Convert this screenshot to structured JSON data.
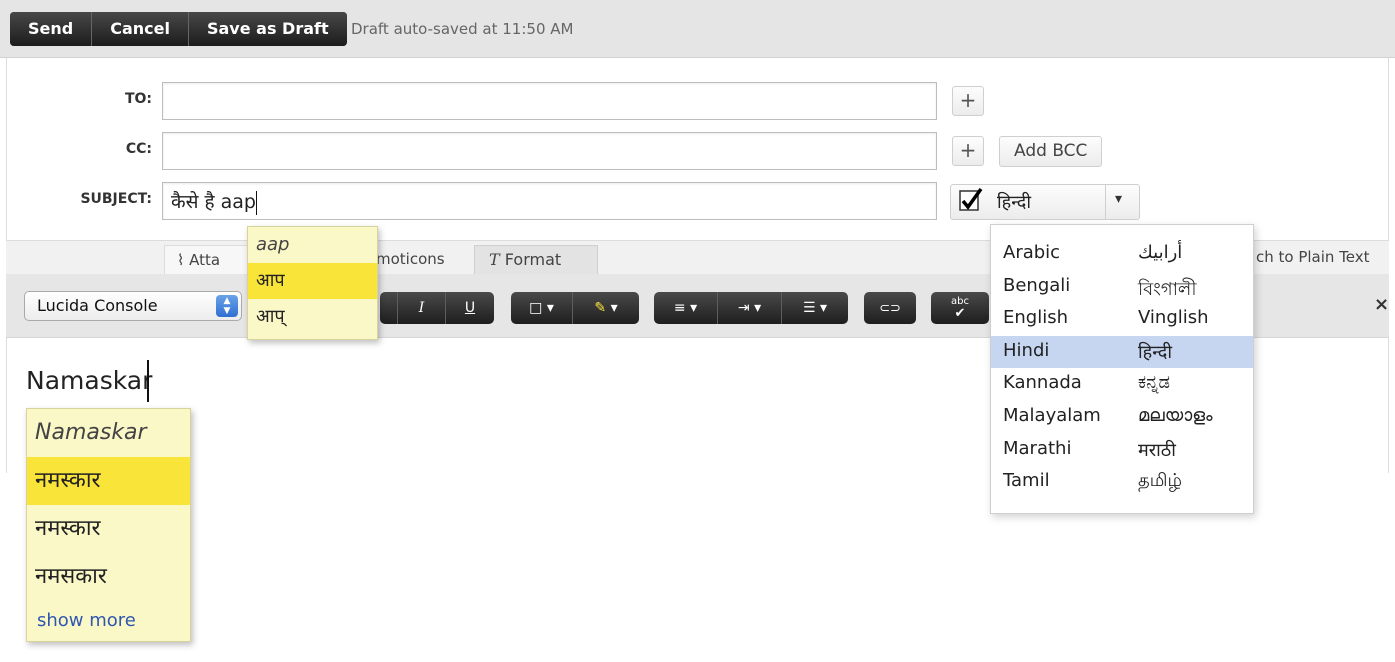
{
  "actions": {
    "send": "Send",
    "cancel": "Cancel",
    "save_draft": "Save as Draft"
  },
  "draft_status": "Draft auto-saved at 11:50 AM",
  "fields": {
    "to_label": "TO:",
    "cc_label": "CC:",
    "subject_label": "SUBJECT:",
    "to_value": "",
    "cc_value": "",
    "subject_value": "कैसे है aap",
    "add_bcc": "Add BCC",
    "plus": "+"
  },
  "language_toggle": {
    "checked": true,
    "current": "हिन्दी",
    "caret": "▾"
  },
  "tabs": {
    "attach": "Atta",
    "emoticons": "moticons",
    "format": "Format",
    "plain_text": "ch to Plain Text"
  },
  "toolbar": {
    "font": "Lucida Console",
    "italic": "I",
    "underline": "U",
    "color_box": "□",
    "highlight": "✎",
    "align": "≡",
    "indent": "⇥",
    "list": "☰",
    "link": "⊂⊃",
    "spell": "abc",
    "close": "×"
  },
  "body_text": "Namaskar",
  "subject_suggestions": [
    {
      "text": "aap",
      "kind": "original"
    },
    {
      "text": "आप",
      "kind": "highlighted"
    },
    {
      "text": "आप्",
      "kind": "normal"
    }
  ],
  "body_suggestions": [
    {
      "text": "Namaskar",
      "kind": "original"
    },
    {
      "text": "नमस्कार",
      "kind": "highlighted"
    },
    {
      "text": "नमस्कार",
      "kind": "normal"
    },
    {
      "text": "नमसकार",
      "kind": "normal"
    }
  ],
  "body_suggestions_more": "show more",
  "languages": [
    {
      "name": "Arabic",
      "native": "أرابيك"
    },
    {
      "name": "Bengali",
      "native": "বিংগালী"
    },
    {
      "name": "English",
      "native": "Vinglish"
    },
    {
      "name": "Hindi",
      "native": "हिन्दी",
      "selected": true
    },
    {
      "name": "Kannada",
      "native": "ಕನ್ನಡ"
    },
    {
      "name": "Malayalam",
      "native": "മലയാളം"
    },
    {
      "name": "Marathi",
      "native": "मराठी"
    },
    {
      "name": "Tamil",
      "native": "தமிழ்"
    }
  ],
  "colors": {
    "highlight": "#f9e43a",
    "suggest_bg": "#fbf8c8",
    "selected_lang": "#c6d6f0",
    "link": "#2f56b0"
  }
}
